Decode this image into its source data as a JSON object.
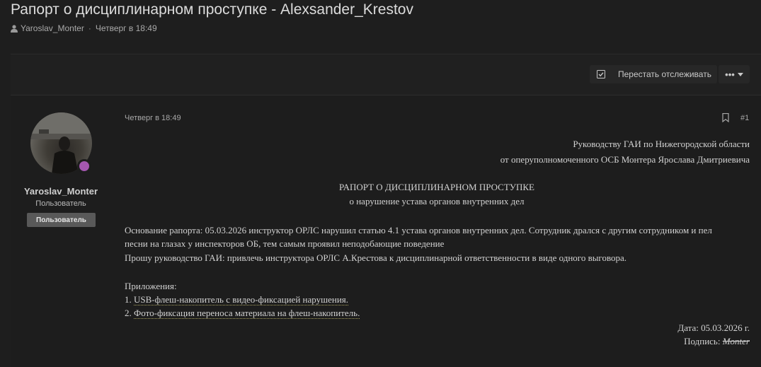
{
  "thread": {
    "title": "Рапорт о дисциплинарном проступке - Alexsander_Krestov",
    "author": "Yaroslav_Monter",
    "separator": "·",
    "date": "Четверг в 18:49"
  },
  "toolbar": {
    "watch_label": "Перестать отслеживать",
    "more_label": "•••"
  },
  "post": {
    "author": "Yaroslav_Monter",
    "user_title": "Пользователь",
    "user_banner": "Пользователь",
    "date": "Четверг в 18:49",
    "number": "#1",
    "addressee_line1": "Руководству ГАИ по Нижегородской области",
    "addressee_line2": "от оперуполномоченного ОСБ Монтера Ярослава Дмитриевича",
    "heading": "РАПОРТ О ДИСЦИПЛИНАРНОМ ПРОСТУПКЕ",
    "subheading": "о нарушение устава органов внутренних дел",
    "body_line1": "Основание рапорта: 05.03.2026 инструктор ОРЛС нарушил статью 4.1 устава органов внутренних дел. Сотрудник дрался с другим сотрудником и пел",
    "body_line2": "песни на глазах у инспекторов ОБ, тем самым проявил неподобающие поведение",
    "body_line3": "Прошу руководство ГАИ: привлечь инструктора ОРЛС А.Крестова к дисциплинарной ответственности в виде одного выговора.",
    "attachments_label": "Приложения:",
    "attachment1_num": "1. ",
    "attachment1": "USB-флеш-накопитель с видео-фиксацией нарушения.",
    "attachment2_num": "2. ",
    "attachment2": "Фото-фиксация переноса материала на флеш-накопитель.",
    "date_line": "Дата: 05.03.2026 г.",
    "signature_label": "Подпись: ",
    "signature": "Monter"
  },
  "colors": {
    "background": "#1e1e1e",
    "online_indicator": "#a457b0",
    "banner": "#595959"
  },
  "icons": [
    "user-icon",
    "checkbox-icon",
    "more-dots-icon",
    "chevron-down-icon",
    "bookmark-icon"
  ]
}
